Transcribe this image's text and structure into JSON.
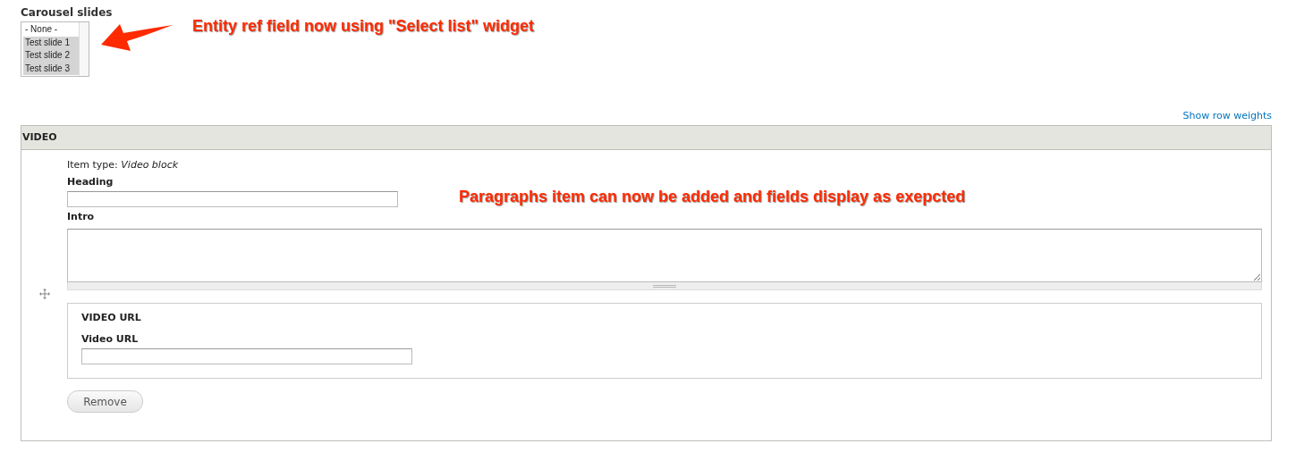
{
  "carousel": {
    "label": "Carousel slides",
    "options": [
      {
        "label": "- None -",
        "selected": false
      },
      {
        "label": "Test slide 1",
        "selected": true
      },
      {
        "label": "Test slide 2",
        "selected": true
      },
      {
        "label": "Test slide 3",
        "selected": true
      }
    ]
  },
  "annotations": [
    "Entity ref field now using \"Select list\" widget",
    "Paragraphs item can now be added and fields display as exepcted"
  ],
  "show_row_weights": "Show row weights",
  "table": {
    "header": "VIDEO",
    "item_type": "Item type: *Video block*",
    "heading_label": "Heading",
    "intro_label": "Intro",
    "fieldset": {
      "legend": "VIDEO URL",
      "label": "Video URL"
    },
    "remove_button": "Remove"
  }
}
